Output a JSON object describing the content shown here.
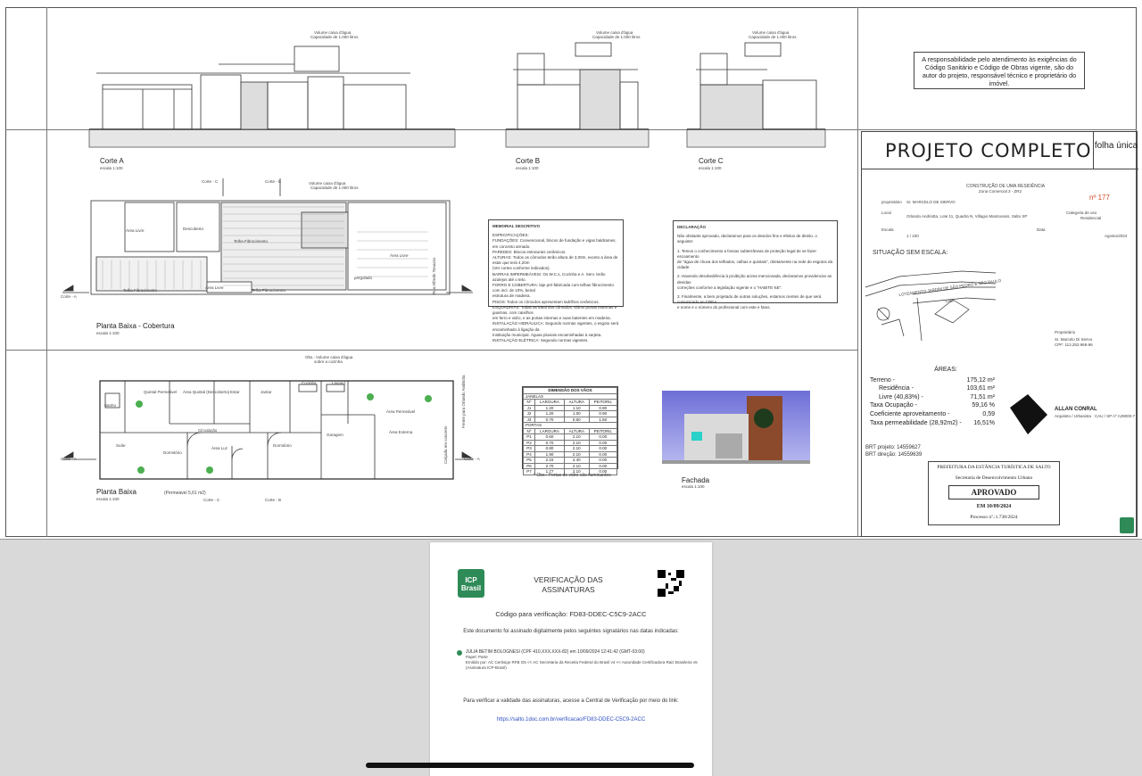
{
  "drawing": {
    "cortes": [
      {
        "label": "Corte A",
        "scale": "escala 1:100",
        "water_tank": "Volume caixa d'água",
        "capacity": "Capacidade de 1.000 litros"
      },
      {
        "label": "Corte B",
        "scale": "escala 1:100",
        "water_tank": "Volume caixa d'água",
        "capacity": "Capacidade de 1.000 litros"
      },
      {
        "label": "Corte C",
        "scale": "escala 1:100",
        "water_tank": "Volume caixa d'água",
        "capacity": "Capacidade de 1.000 litros"
      }
    ],
    "responsibility_note": "A responsabilidade pelo atendimento às exigências do Código Sanitário e Código de Obras vigente, são do autor do projeto, responsável técnico e proprietário do imóvel.",
    "roof_plan": {
      "title": "Planta Baixa - Cobertura",
      "scale": "escala 1:100",
      "water_tank": "Volume caixa d'água",
      "capacity": "Capacidade de 1.000 litros",
      "labels": [
        "Área Livre",
        "Descoberto",
        "Telha Fibrocimento",
        "Área Livre",
        "Telha Fibrocimento",
        "Telha Fibrocimento",
        "Área Livre",
        "pergolado"
      ],
      "street": "Rua Alfredo Tonazzo"
    },
    "floor_plan": {
      "title": "Planta Baixa",
      "scale": "escala 1:100",
      "permeable": "(Permeável 5,61 m2)",
      "obs": "Obs.: Volume caixa d'água",
      "obs2": "sobre a cozinha",
      "rooms": [
        "Quintal Permeável",
        "Área Quintal (Descoberto)",
        "Estar",
        "Jantar",
        "Cozinha",
        "Lavand.",
        "Área Permeável",
        "Suíte",
        "Dormitório",
        "Circulação",
        "Área Luz",
        "Dormitório",
        "Garagem",
        "Área Externa",
        "Banho"
      ],
      "street": "Frente para Orlando Andriotta",
      "calcada": "Calçada em concreto"
    },
    "cut_markers": [
      "Corte - A",
      "Corte - B",
      "Corte - C"
    ],
    "memorial": {
      "title": "MEMORIAL DESCRITIVO",
      "lines": [
        "ESPECIFICAÇÕES:",
        "FUNDAÇÕES: Convencional, blocos de fundação e vigas baldrames, em concreto armado.",
        "PAREDES: Blocos estruturais cerâmicos.",
        "ALTURAS: Todos os cômodos terão altura de 3,00m, exceto a área de estar que terá 4,20m",
        "(Ver cortes conforme indicados).",
        "BARRAS IMPERMEÁVEIS: Os W.C.s, Cozinha e A. Serv. terão azulejos até o teto.",
        "FORRO E COBERTURA: laje pré-fabricada com telhas fibrocimento com incl. de 10%, beiral",
        "estrutura de madeira.",
        "PISOS: Todos os cômodos apresentam ladrilhos cerâmicos.",
        "ESQUADRIAS: Todas as ideal dos cômodos, vidros portas externas e guarnas, com caixilhos",
        "em ferro e vidro, e as portas internas e suas batentes em madeira.",
        "INSTALAÇÃO HIDRÁULICA: Segundo normas vigentes, o esgoto será encaminhado à ligação da",
        "Instituição municipal. Águas pluviais encaminhadas à sarjeta.",
        "INSTALAÇÃO ELÉTRICA: Segundo normas vigentes."
      ]
    },
    "declaracao": {
      "title": "DECLARAÇÃO",
      "lines": [
        "Não obstante aprovado, declaramos para os devidos fins e efeitos de direito, o seguinte:",
        "1. Temos o conhecimento a fossas subterrâneas de proteção legal de se fazer escoamento",
        "de \"água de chuva dos telhados, calhas e quintais\", diretamente na rede de esgotos da cidade.",
        "2. Havendo desobediência à proibição acima mencionada, declaramos providenciar as devidas",
        "correções conforme a legislação vigente e o \"HABITE-SE\".",
        "3. Finalmente, a bem projetado de outras soluções, estamos cientes de que será comunicado ao CREA",
        "e nome e o número do profissional com este e fatos."
      ]
    },
    "dimension_table": {
      "title": "DIMENSÃO DOS VÃOS",
      "janelas_label": "JANELAS",
      "portas_label": "PORTAS",
      "headers": [
        "Nº",
        "LARGURA",
        "ALTURA",
        "PEITORIL"
      ],
      "janelas": [
        [
          "J1",
          "1.20",
          "1.10",
          "0.90"
        ],
        [
          "J2",
          "1.20",
          "1.00",
          "0.90"
        ],
        [
          "J3",
          "0.70",
          "0.60",
          "1.50"
        ]
      ],
      "portas": [
        [
          "P1",
          "0.60",
          "2.10",
          "0.00"
        ],
        [
          "P2",
          "0.70",
          "2.10",
          "0.00"
        ],
        [
          "P3",
          "0.80",
          "2.10",
          "0.00"
        ],
        [
          "P4",
          "1.90",
          "2.10",
          "0.00"
        ],
        [
          "P5",
          "2.15",
          "2.40",
          "0.00"
        ],
        [
          "P6",
          "2.70",
          "2.10",
          "0.00"
        ],
        [
          "P7",
          "1.77",
          "2.10",
          "0.00"
        ]
      ],
      "obs": "* Obs.: Portas de vidro vão-iluminantes"
    },
    "fachada": {
      "label": "Fachada",
      "scale": "escala 1:100"
    },
    "title_block": {
      "title": "PROJETO COMPLETO",
      "sheet": "folha única",
      "subtitle": "CONSTRUÇÃO DE UMA RESIDÊNCIA",
      "zone": "Zona Comercial 3 - ZR2",
      "number": "nº 177",
      "owner_label": "proprietário",
      "owner": "Sr. MARCELO DE SIERVO",
      "local_label": "Local",
      "local": "Orlando Andriotta, Lote 11, Quadra N, Villagio Mantovanis, Salto SP",
      "category_label": "Categoria de uso",
      "category": "Residencial",
      "scale_label": "Escala",
      "scale": "1 / 100",
      "data_label": "Data",
      "date": "Agosto/2024",
      "situacao": "SITUAÇÃO SEM ESCALA:",
      "street1": "LOTEAMENTO JARDIM DE SÃO PEDRO E SÃO PAULO",
      "street2": "Lote",
      "owner_sig_label": "Proprietário",
      "owner_sig": "Sr. Marcelo Di Siervo",
      "owner_cpf": "CPF: 113.253.968-96",
      "author": "ALLAN CONRAL",
      "author_role": "Arquiteto / Urbanista",
      "author_cau": "CAU / SP nº A29000-7",
      "brt_projeto": "BRT projeto: 14559627",
      "brt_direcao": "BRT direção: 14559639"
    },
    "areas": {
      "title": "ÁREAS:",
      "rows": [
        {
          "label": "Terreno -",
          "value": "175,12 m²"
        },
        {
          "label": "Residência -",
          "value": "103,61 m²"
        },
        {
          "label": "Livre (40,83%) -",
          "value": "71,51 m²"
        },
        {
          "label": "Taxa Ocupação -",
          "value": "59,16 %"
        },
        {
          "label": "Coeficiente aproveitamento -",
          "value": "0,59"
        },
        {
          "label": "Taxa permeabilidade (28,92m2) -",
          "value": "16,51%"
        }
      ]
    },
    "approval_stamp": {
      "line1": "PREFEITURA DA ESTÂNCIA TURÍSTICA DE SALTO",
      "line2": "Secretaria de Desenvolvimento Urbano",
      "status": "APROVADO",
      "date": "EM 10/09/2024",
      "process": "Processo nº.:1.738/2024"
    }
  },
  "verification": {
    "logo_text": "ICP Brasil",
    "title": "VERIFICAÇÃO DAS ASSINATURAS",
    "code_line": "Código para verificação: FD83-DDEC-C5C9-2ACC",
    "intro": "Este documento foi assinado digitalmente pelos seguintes signatários nas datas indicadas:",
    "signer": "JULIA BETIM BOLOGNESI (CPF 410.XXX.XXX-82) em 10/09/2024 12:41:42 (GMT-03:00)",
    "signer_detail1": "Papel: Parte",
    "signer_detail2": "Emitido por: AC Certisign RFB G5 << AC Secretaria da Receita Federal do Brasil v4 << Autoridade Certificadora Raiz Brasileira v5",
    "signer_detail3": "(Assinatura ICP-Brasil)",
    "verify_text": "Para verificar a validade das assinaturas, acesse a Central de Verificação por meio do link:",
    "link": "https://salto.1doc.com.br/verificacao/FD83-DDEC-C5C9-2ACC"
  }
}
